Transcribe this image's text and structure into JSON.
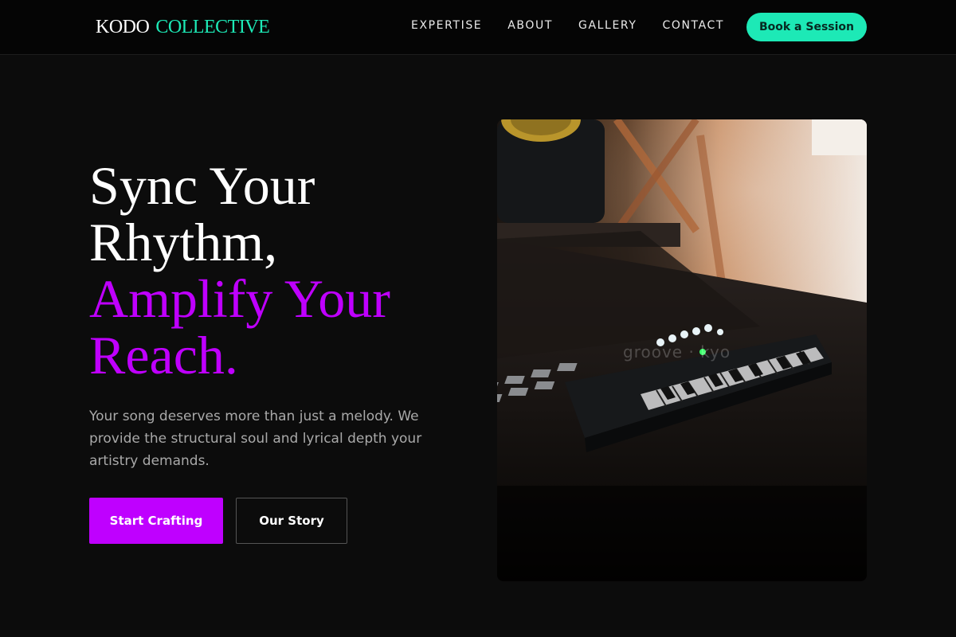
{
  "brand": {
    "part1": "KODO",
    "part2": "COLLECTIVE"
  },
  "nav": {
    "links": [
      {
        "label": "EXPERTISE"
      },
      {
        "label": "ABOUT"
      },
      {
        "label": "GALLERY"
      },
      {
        "label": "CONTACT"
      }
    ],
    "cta_label": "Book a Session"
  },
  "hero": {
    "title_lines": [
      "Sync Your",
      "Rhythm,"
    ],
    "highlight_lines": [
      "Amplify Your",
      "Reach."
    ],
    "description": "Your song deserves more than just a melody. We provide the structural soul and lyrical depth your artistry demands.",
    "primary_button": "Start Crafting",
    "secondary_button": "Our Story"
  },
  "image": {
    "subject": "midi-keyboard-studio-photo",
    "watermark": "groove · kyo"
  },
  "colors": {
    "accent_teal": "#1de9b6",
    "accent_purple": "#bf00ff",
    "background": "#0c0c0c"
  }
}
